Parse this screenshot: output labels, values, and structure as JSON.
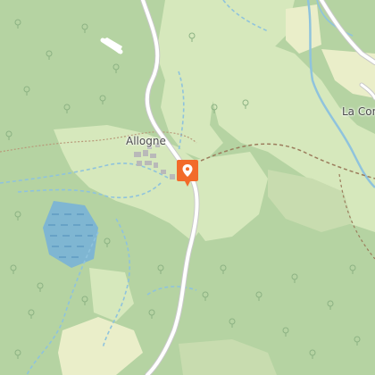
{
  "map": {
    "places": {
      "allogne": "Allogne",
      "la_com": "La Com"
    },
    "marker": {
      "icon": "location-pin-icon",
      "color": "#f26b2a"
    },
    "colors": {
      "forest": "#b5d3a2",
      "open_land": "#d8e9bd",
      "farmland": "#e6ecc8",
      "water": "#8fc3dd",
      "marsh": "#6aa5c9",
      "road": "#ffffff",
      "road_casing": "#c8c8c8",
      "trail": "#9b7c5c",
      "tree_symbol": "#8cb283"
    }
  }
}
